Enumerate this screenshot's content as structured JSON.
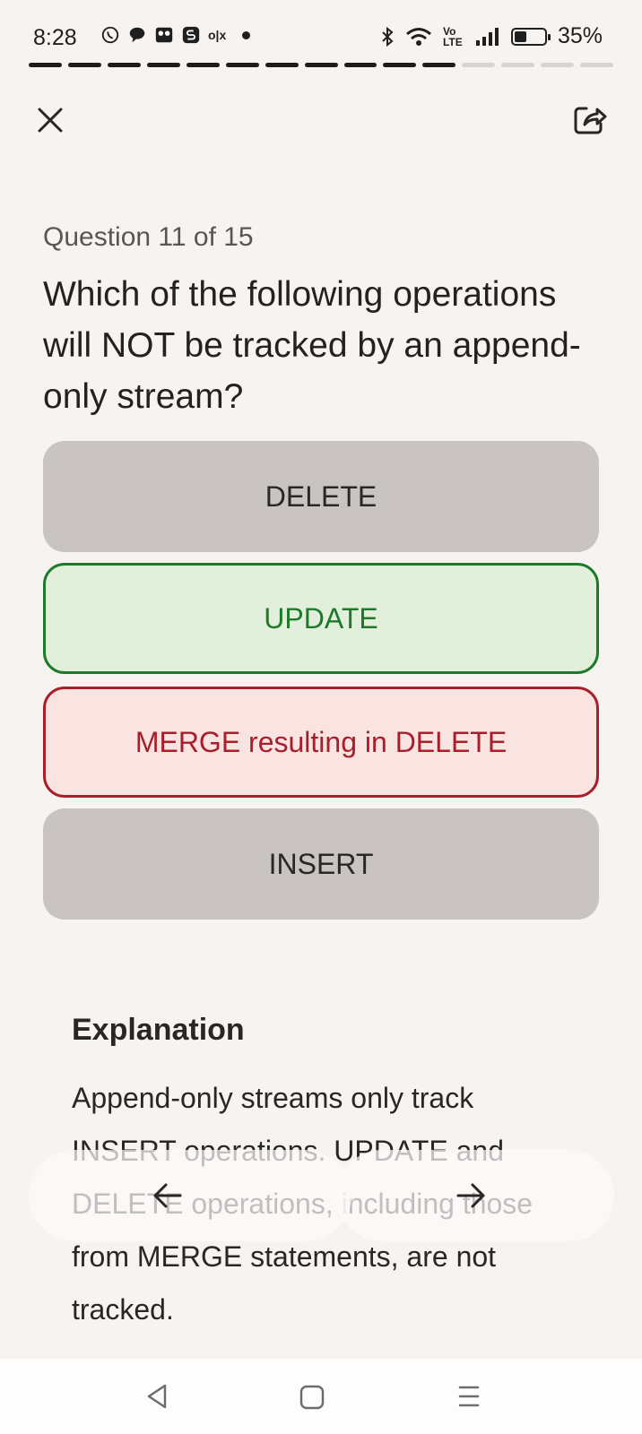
{
  "status_bar": {
    "time": "8:28",
    "olx": "o|x",
    "network": "Vo LTE",
    "battery": "35%"
  },
  "progress": {
    "current": 11,
    "total": 15
  },
  "question": {
    "counter": "Question 11 of 15",
    "text": "Which of the following operations will NOT be tracked by an append-only stream?"
  },
  "options": [
    {
      "label": "DELETE",
      "state": "neutral"
    },
    {
      "label": "UPDATE",
      "state": "correct"
    },
    {
      "label": "MERGE resulting in DELETE",
      "state": "incorrect"
    },
    {
      "label": "INSERT",
      "state": "neutral"
    }
  ],
  "explanation": {
    "title": "Explanation",
    "body": "Append-only streams only track INSERT operations. UPDATE and DELETE operations, including those from MERGE statements, are not tracked."
  },
  "colors": {
    "correct": "#1d7a2a",
    "incorrect": "#a81e2a",
    "neutral_option": "#c9c4c2",
    "background": "#f7f3f1"
  },
  "icons": {
    "close": "close-icon",
    "share": "share-icon",
    "previous": "arrow-left-icon",
    "next": "arrow-right-icon",
    "system_back": "triangle-back-icon",
    "system_home": "square-home-icon",
    "system_menu": "three-lines-menu-icon"
  }
}
